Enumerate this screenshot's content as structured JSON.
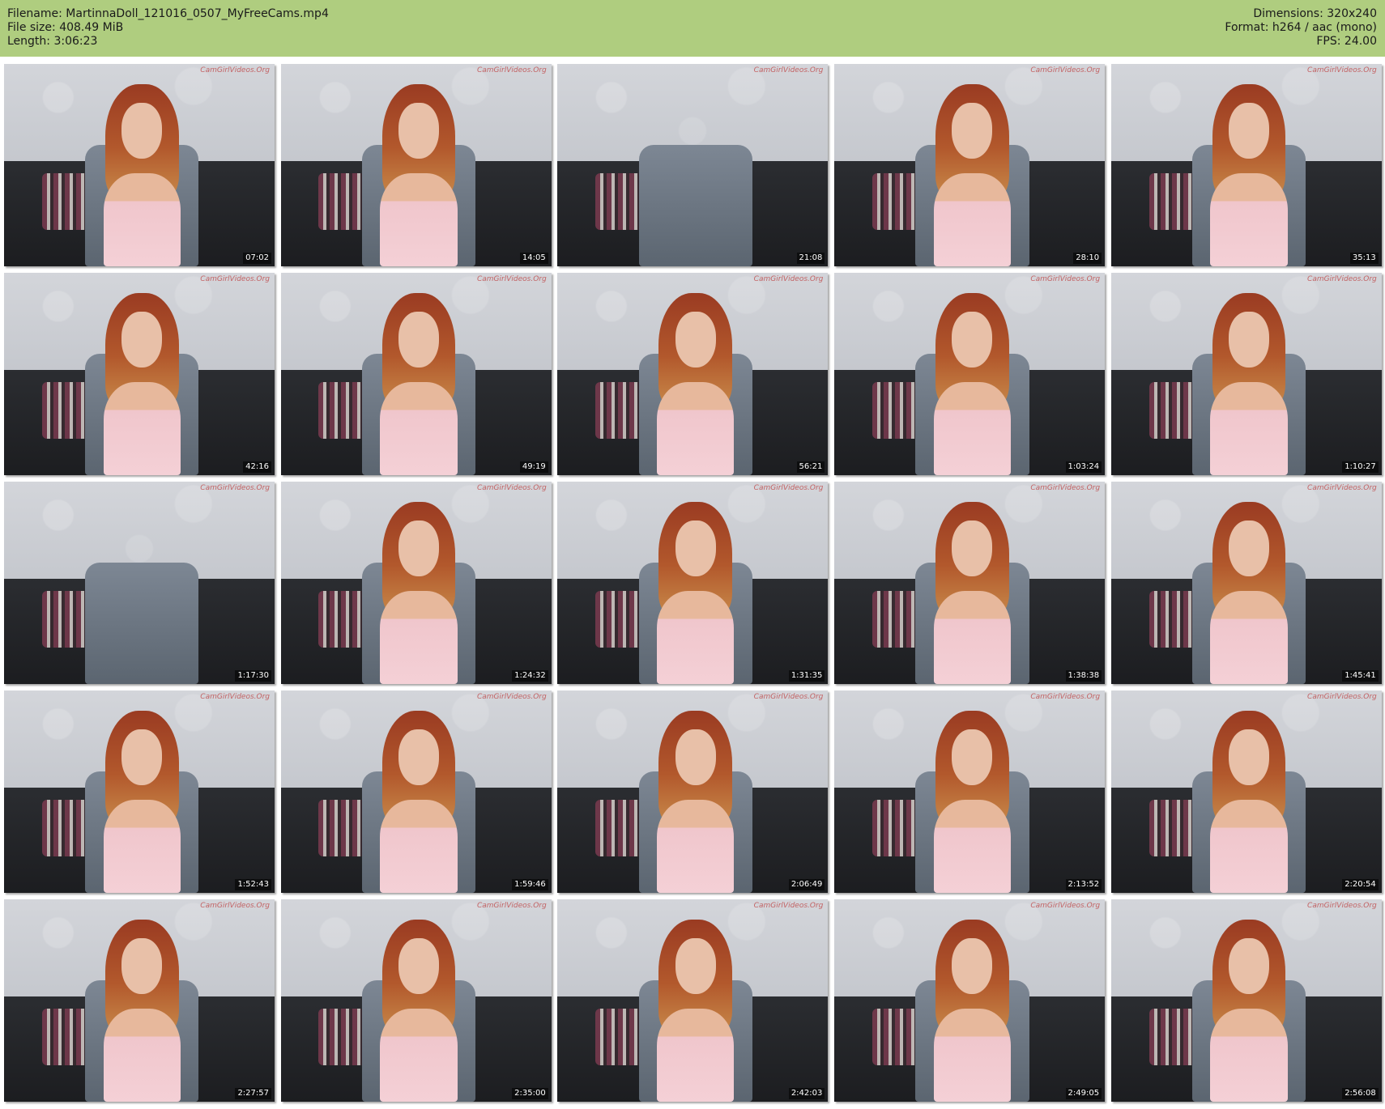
{
  "header": {
    "filename_line": "Filename: MartinnaDoll_121016_0507_MyFreeCams.mp4",
    "filesize_line": "File size: 408.49 MiB",
    "length_line": "Length: 3:06:23",
    "dimensions_line": "Dimensions: 320x240",
    "format_line": "Format: h264 / aac (mono)",
    "fps_line": "FPS: 24.00"
  },
  "watermark": "CamGirlVideos.Org",
  "thumbnails": [
    {
      "time": "07:02"
    },
    {
      "time": "14:05"
    },
    {
      "time": "21:08"
    },
    {
      "time": "28:10"
    },
    {
      "time": "35:13"
    },
    {
      "time": "42:16"
    },
    {
      "time": "49:19"
    },
    {
      "time": "56:21"
    },
    {
      "time": "1:03:24"
    },
    {
      "time": "1:10:27"
    },
    {
      "time": "1:17:30"
    },
    {
      "time": "1:24:32"
    },
    {
      "time": "1:31:35"
    },
    {
      "time": "1:38:38"
    },
    {
      "time": "1:45:41"
    },
    {
      "time": "1:52:43"
    },
    {
      "time": "1:59:46"
    },
    {
      "time": "2:06:49"
    },
    {
      "time": "2:13:52"
    },
    {
      "time": "2:20:54"
    },
    {
      "time": "2:27:57"
    },
    {
      "time": "2:35:00"
    },
    {
      "time": "2:42:03"
    },
    {
      "time": "2:49:05"
    },
    {
      "time": "2:56:08"
    }
  ],
  "colors": {
    "header_background": "#afcd7f"
  }
}
